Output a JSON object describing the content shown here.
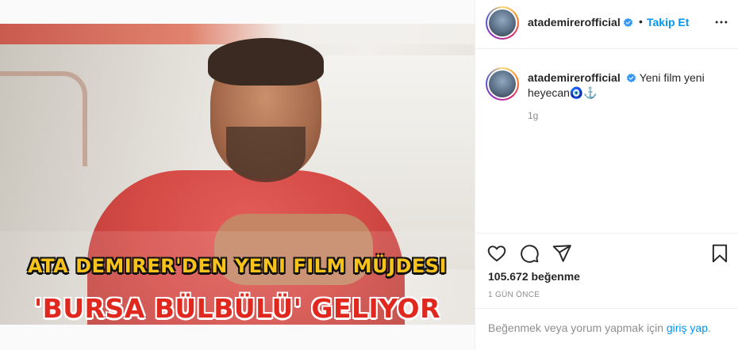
{
  "media": {
    "headline_line1": "ATA DEMIRER'DEN YENI FILM MÜJDESI",
    "headline_line2": "'BURSA BÜLBÜLÜ' GELIYOR"
  },
  "header": {
    "username": "atademirerofficial",
    "separator": "•",
    "follow_label": "Takip Et",
    "more_icon": "more-horizontal-icon"
  },
  "caption": {
    "username": "atademirerofficial",
    "text": "Yeni film yeni heyecan🧿⚓️",
    "age": "1g"
  },
  "actions": {
    "like_icon": "heart-icon",
    "comment_icon": "comment-icon",
    "share_icon": "send-icon",
    "save_icon": "bookmark-icon",
    "likes": "105.672 beğenme",
    "posted": "1 GÜN ÖNCE"
  },
  "login": {
    "prefix": "Beğenmek veya yorum yapmak için ",
    "link": "giriş yap",
    "suffix": "."
  },
  "colors": {
    "link": "#0095f6",
    "verified": "#3897f0",
    "muted": "#8e8e8e"
  }
}
